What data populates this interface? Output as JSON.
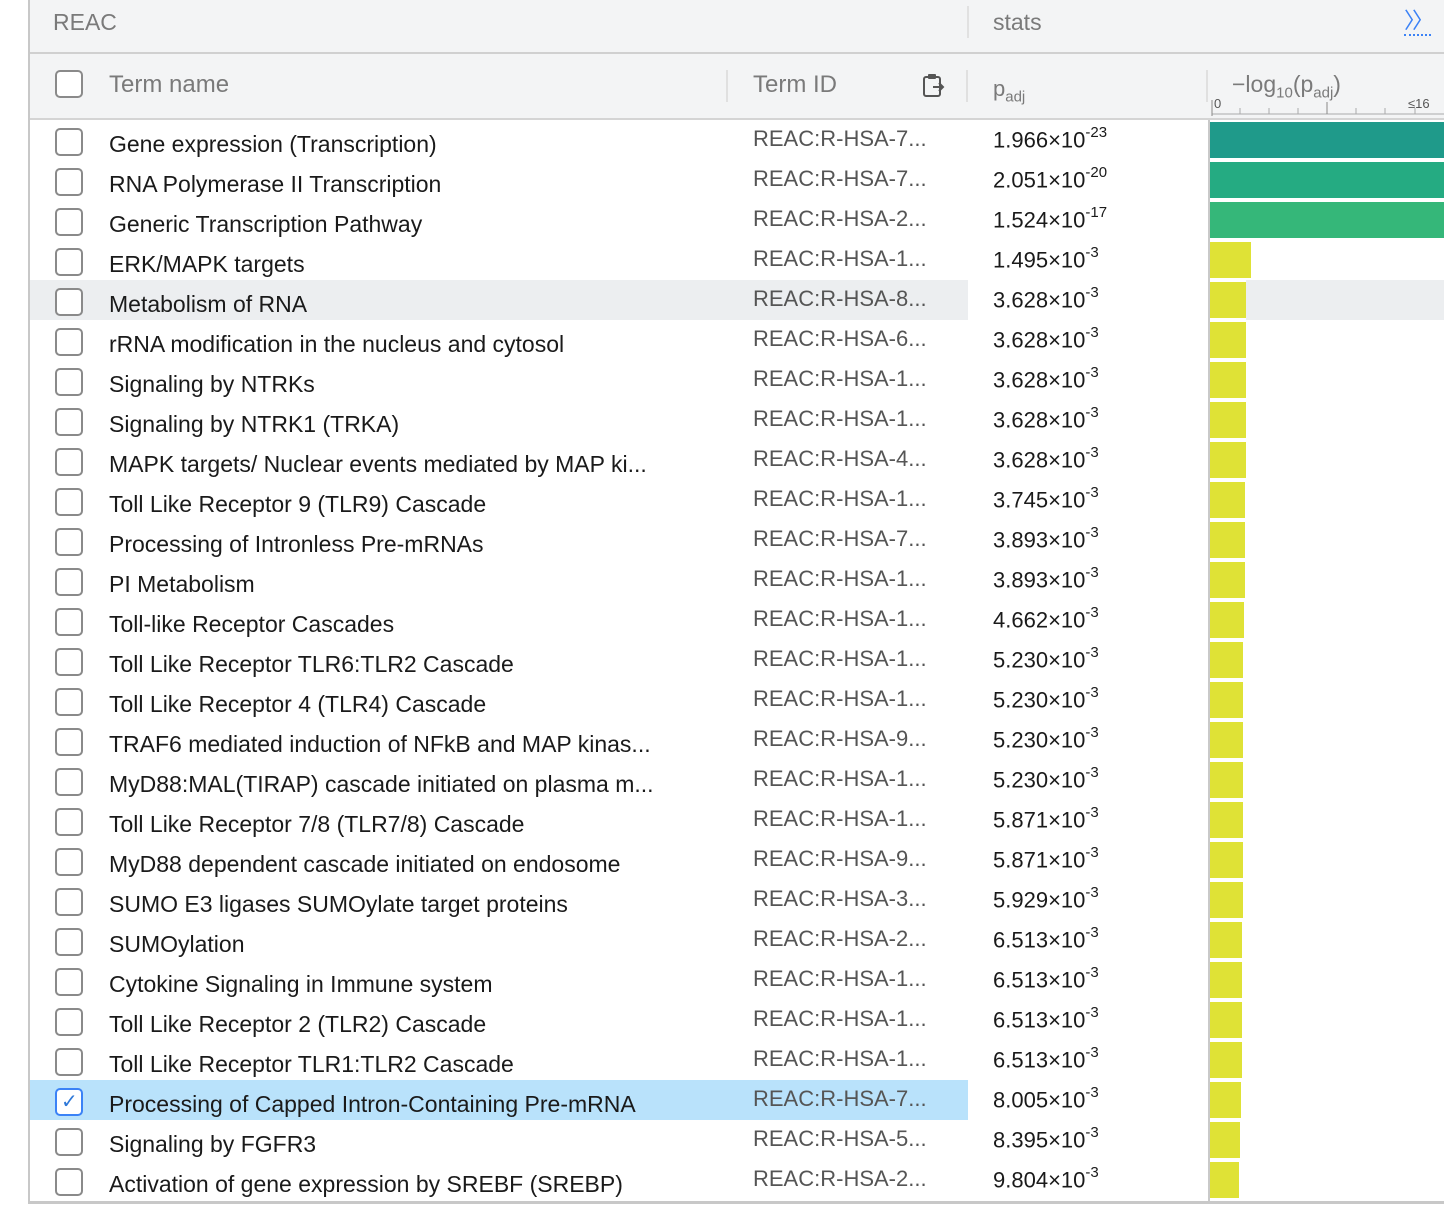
{
  "header": {
    "source": "REAC",
    "stats": "stats",
    "expand_label": "〉〉"
  },
  "columns": {
    "term_name": "Term name",
    "term_id": "Term ID",
    "padj_main": "p",
    "padj_sub": "adj",
    "log_prefix": "−log",
    "log_sub": "10",
    "log_mid": "(p",
    "log_sub2": "adj",
    "log_end": ")",
    "scale_min": "0",
    "scale_max": "≤16"
  },
  "rows": [
    {
      "name": "Gene expression (Transcription)",
      "id": "REAC:R-HSA-7...",
      "mant": "1.966",
      "exp": "-23",
      "checked": false
    },
    {
      "name": "RNA Polymerase II Transcription",
      "id": "REAC:R-HSA-7...",
      "mant": "2.051",
      "exp": "-20",
      "checked": false
    },
    {
      "name": "Generic Transcription Pathway",
      "id": "REAC:R-HSA-2...",
      "mant": "1.524",
      "exp": "-17",
      "checked": false
    },
    {
      "name": "ERK/MAPK targets",
      "id": "REAC:R-HSA-1...",
      "mant": "1.495",
      "exp": "-3",
      "checked": false
    },
    {
      "name": "Metabolism of RNA",
      "id": "REAC:R-HSA-8...",
      "mant": "3.628",
      "exp": "-3",
      "checked": false
    },
    {
      "name": "rRNA modification in the nucleus and cytosol",
      "id": "REAC:R-HSA-6...",
      "mant": "3.628",
      "exp": "-3",
      "checked": false
    },
    {
      "name": "Signaling by NTRKs",
      "id": "REAC:R-HSA-1...",
      "mant": "3.628",
      "exp": "-3",
      "checked": false
    },
    {
      "name": "Signaling by NTRK1 (TRKA)",
      "id": "REAC:R-HSA-1...",
      "mant": "3.628",
      "exp": "-3",
      "checked": false
    },
    {
      "name": "MAPK targets/ Nuclear events mediated by MAP ki...",
      "id": "REAC:R-HSA-4...",
      "mant": "3.628",
      "exp": "-3",
      "checked": false
    },
    {
      "name": "Toll Like Receptor 9 (TLR9) Cascade",
      "id": "REAC:R-HSA-1...",
      "mant": "3.745",
      "exp": "-3",
      "checked": false
    },
    {
      "name": "Processing of Intronless Pre-mRNAs",
      "id": "REAC:R-HSA-7...",
      "mant": "3.893",
      "exp": "-3",
      "checked": false
    },
    {
      "name": "PI Metabolism",
      "id": "REAC:R-HSA-1...",
      "mant": "3.893",
      "exp": "-3",
      "checked": false
    },
    {
      "name": "Toll-like Receptor Cascades",
      "id": "REAC:R-HSA-1...",
      "mant": "4.662",
      "exp": "-3",
      "checked": false
    },
    {
      "name": "Toll Like Receptor TLR6:TLR2 Cascade",
      "id": "REAC:R-HSA-1...",
      "mant": "5.230",
      "exp": "-3",
      "checked": false
    },
    {
      "name": "Toll Like Receptor 4 (TLR4) Cascade",
      "id": "REAC:R-HSA-1...",
      "mant": "5.230",
      "exp": "-3",
      "checked": false
    },
    {
      "name": "TRAF6 mediated induction of NFkB and MAP kinas...",
      "id": "REAC:R-HSA-9...",
      "mant": "5.230",
      "exp": "-3",
      "checked": false
    },
    {
      "name": "MyD88:MAL(TIRAP) cascade initiated on plasma m...",
      "id": "REAC:R-HSA-1...",
      "mant": "5.230",
      "exp": "-3",
      "checked": false
    },
    {
      "name": "Toll Like Receptor 7/8 (TLR7/8) Cascade",
      "id": "REAC:R-HSA-1...",
      "mant": "5.871",
      "exp": "-3",
      "checked": false
    },
    {
      "name": "MyD88 dependent cascade initiated on endosome",
      "id": "REAC:R-HSA-9...",
      "mant": "5.871",
      "exp": "-3",
      "checked": false
    },
    {
      "name": "SUMO E3 ligases SUMOylate target proteins",
      "id": "REAC:R-HSA-3...",
      "mant": "5.929",
      "exp": "-3",
      "checked": false
    },
    {
      "name": "SUMOylation",
      "id": "REAC:R-HSA-2...",
      "mant": "6.513",
      "exp": "-3",
      "checked": false
    },
    {
      "name": "Cytokine Signaling in Immune system",
      "id": "REAC:R-HSA-1...",
      "mant": "6.513",
      "exp": "-3",
      "checked": false
    },
    {
      "name": "Toll Like Receptor 2 (TLR2) Cascade",
      "id": "REAC:R-HSA-1...",
      "mant": "6.513",
      "exp": "-3",
      "checked": false
    },
    {
      "name": "Toll Like Receptor TLR1:TLR2 Cascade",
      "id": "REAC:R-HSA-1...",
      "mant": "6.513",
      "exp": "-3",
      "checked": false
    },
    {
      "name": "Processing of Capped Intron-Containing Pre-mRNA",
      "id": "REAC:R-HSA-7...",
      "mant": "8.005",
      "exp": "-3",
      "checked": true
    },
    {
      "name": "Signaling by FGFR3",
      "id": "REAC:R-HSA-5...",
      "mant": "8.395",
      "exp": "-3",
      "checked": false
    },
    {
      "name": "Activation of gene expression by SREBF (SREBP)",
      "id": "REAC:R-HSA-2...",
      "mant": "9.804",
      "exp": "-3",
      "checked": false
    }
  ],
  "hover_row_index": 4,
  "bar_colors": {
    "strong1": "#1f9a8a",
    "strong2": "#25ab82",
    "strong3": "#35b779",
    "weak": "#dfe236"
  }
}
